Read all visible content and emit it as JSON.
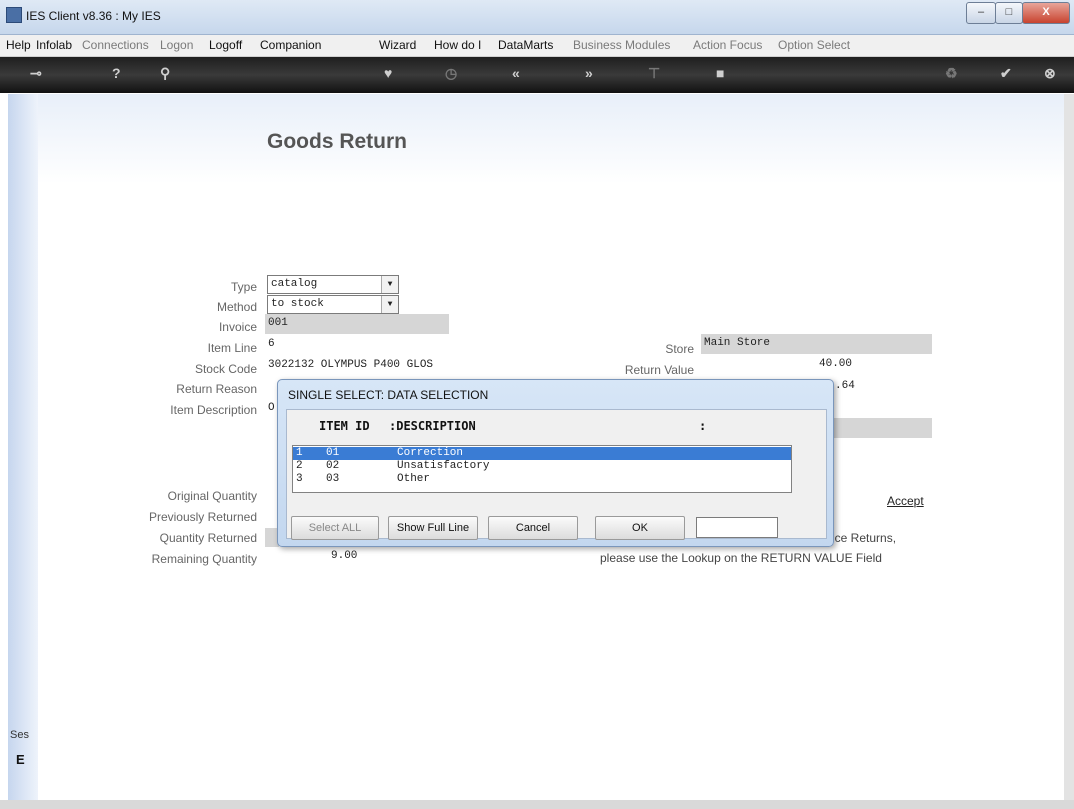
{
  "window": {
    "title": "IES Client v8.36 : My IES",
    "min_label": "–",
    "max_label": "□",
    "close_label": "X"
  },
  "menu": [
    {
      "label": "Help",
      "enabled": true
    },
    {
      "label": "Infolab",
      "enabled": true
    },
    {
      "label": "Connections",
      "enabled": false
    },
    {
      "label": "Logon",
      "enabled": false
    },
    {
      "label": "Logoff",
      "enabled": true
    },
    {
      "label": "Companion",
      "enabled": true
    },
    {
      "label": "Wizard",
      "enabled": true
    },
    {
      "label": "How do I",
      "enabled": true
    },
    {
      "label": "DataMarts",
      "enabled": true
    },
    {
      "label": "Business Modules",
      "enabled": false
    },
    {
      "label": "Action Focus",
      "enabled": false
    },
    {
      "label": "Option Select",
      "enabled": false
    }
  ],
  "toolbar_icons": [
    "key-icon",
    "help-icon",
    "search-icon",
    "heart-icon",
    "clock-icon",
    "back-icon",
    "forward-icon",
    "tree-icon",
    "stop-icon",
    "recycle-icon",
    "check-icon",
    "close-icon"
  ],
  "form": {
    "heading": "Goods Return",
    "labels": {
      "type": "Type",
      "method": "Method",
      "invoice": "Invoice",
      "item_line": "Item Line",
      "stock_code": "Stock Code",
      "return_reason": "Return Reason",
      "item_description": "Item Description",
      "original_quantity": "Original Quantity",
      "previously_returned": "Previously Returned",
      "quantity_returned": "Quantity Returned",
      "remaining_quantity": "Remaining Quantity",
      "store": "Store",
      "return_value": "Return Value"
    },
    "values": {
      "type": "catalog",
      "method": "to stock",
      "invoice": "001",
      "item_line": "6",
      "stock_code": "3022132 OLYMPUS P400 GLOS",
      "item_description": "O",
      "remaining_quantity": "9.00",
      "store": "Main Store",
      "return_value": "40.00",
      "extra_value": ".64"
    },
    "accept": "Accept",
    "note_line1": "ice Returns,",
    "note_line2": "please use the Lookup on the RETURN VALUE Field"
  },
  "dialog": {
    "title": "SINGLE SELECT: DATA SELECTION",
    "col_id": "ITEM ID",
    "col_desc": ":DESCRIPTION",
    "col_colon": ":",
    "rows": [
      {
        "n": "1",
        "id": "01",
        "desc": "Correction",
        "selected": true
      },
      {
        "n": "2",
        "id": "02",
        "desc": "Unsatisfactory",
        "selected": false
      },
      {
        "n": "3",
        "id": "03",
        "desc": "Other",
        "selected": false
      }
    ],
    "buttons": {
      "select_all": "Select ALL",
      "show_full": "Show Full Line",
      "cancel": "Cancel",
      "ok": "OK"
    },
    "input_value": ""
  },
  "session": {
    "label": "Ses",
    "icon_text": "E"
  }
}
